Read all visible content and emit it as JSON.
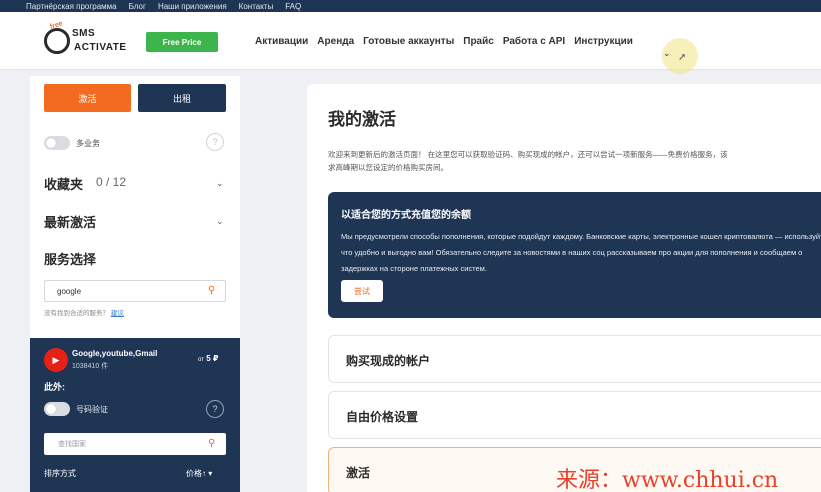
{
  "topbar": {
    "links": [
      "Партнёрская программа",
      "Блог",
      "Наши приложения",
      "Контакты",
      "FAQ"
    ]
  },
  "header": {
    "logo_text_top": "SMS",
    "logo_text_bottom": "ACTIVATE",
    "logo_tag": "free",
    "free_price_label": "Free Price",
    "nav": [
      "Активации",
      "Аренда",
      "Готовые аккаунты",
      "Прайс",
      "Работа с API",
      "Инструкции"
    ],
    "nav_more_icon": "chevron-down-icon"
  },
  "sidebar": {
    "activate_label": "激活",
    "rent_label": "出租",
    "multi_service_label": "多业务",
    "help_glyph": "?",
    "favorites_title": "收藏夹",
    "favorites_count": "0 / 12",
    "recent_title": "最新激活",
    "service_select_title": "服务选择",
    "search_value": "google",
    "no_service_text": "没有找到合适的服务？",
    "no_service_link": "建议"
  },
  "service_card": {
    "name": "Google,youtube,Gmail",
    "count": "1038410 件",
    "price_prefix": "от",
    "price": "5 ₽",
    "other_label": "此外:",
    "number_verify_label": "号码验证",
    "help_glyph": "?",
    "country_search_placeholder": "查找国家",
    "sort_label": "排序方式",
    "sort_value": "价格↑ ▾"
  },
  "main": {
    "title": "我的激活",
    "intro_line1": "欢迎来到更新后的激活页面！ 在这里您可以获取验证码、购买现成的帐户，还可以尝试一项新服务——免费价格服务，该",
    "intro_line2": "求高峰期以您设定的价格购买房间。",
    "topup_title": "以适合您的方式充值您的余额",
    "topup_text": "Мы предусмотрели способы пополнения, которые подойдут каждому. Банковские карты, электронные кошел криптовалюта — используйте то, что удобно и выгодно вам! Обязательно следите за новостями в наших соц рассказываем про акции для пополнения и сообщаем о задержках на стороне платежных систем.",
    "try_label": "尝试",
    "accordion": [
      "购买现成的帐户",
      "自由价格设置",
      "激活"
    ]
  },
  "watermark": "来源：www.chhui.cn",
  "colors": {
    "accent": "#f26b21",
    "navy": "#1f3554",
    "green": "#3cb64c",
    "youtube": "#e62117"
  }
}
